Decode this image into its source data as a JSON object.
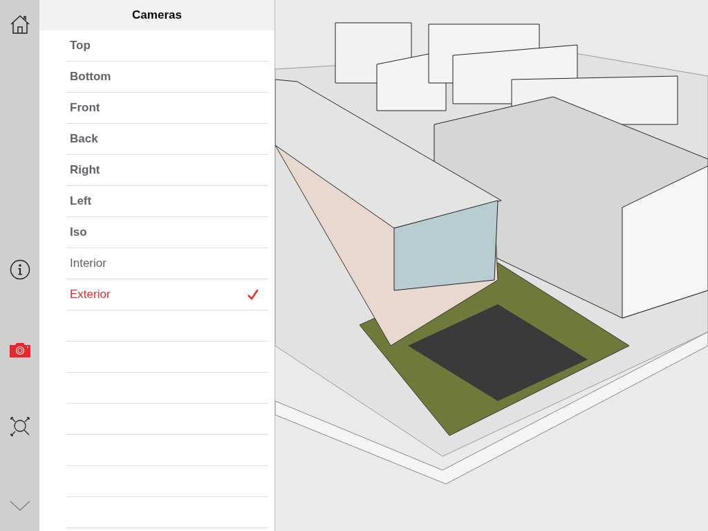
{
  "toolbar": [
    {
      "kind": "home",
      "selected": false
    },
    {
      "kind": "info",
      "selected": false
    },
    {
      "kind": "camera",
      "selected": true
    },
    {
      "kind": "zoom-extents",
      "selected": false
    },
    {
      "kind": "chevron",
      "selected": false
    }
  ],
  "panel": {
    "title": "Cameras",
    "items": [
      {
        "label": "Top",
        "kind": "standard",
        "selected": false
      },
      {
        "label": "Bottom",
        "kind": "standard",
        "selected": false
      },
      {
        "label": "Front",
        "kind": "standard",
        "selected": false
      },
      {
        "label": "Back",
        "kind": "standard",
        "selected": false
      },
      {
        "label": "Right",
        "kind": "standard",
        "selected": false
      },
      {
        "label": "Left",
        "kind": "standard",
        "selected": false
      },
      {
        "label": "Iso",
        "kind": "standard",
        "selected": false
      },
      {
        "label": "Interior",
        "kind": "scene",
        "selected": false
      },
      {
        "label": "Exterior",
        "kind": "scene",
        "selected": true
      }
    ]
  }
}
